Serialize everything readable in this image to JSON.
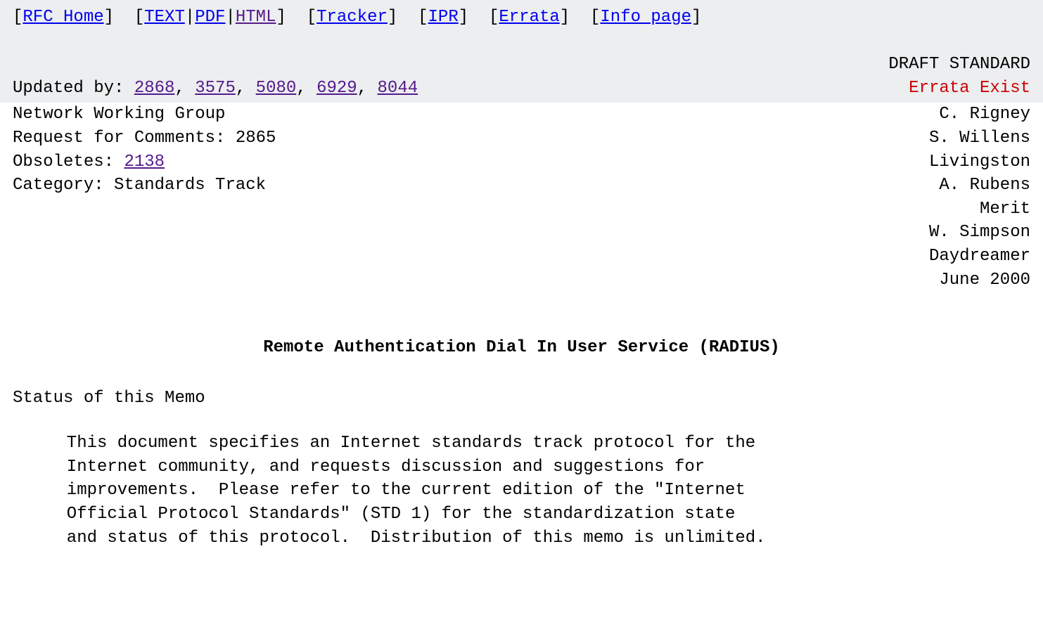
{
  "nav": {
    "rfc_home": "RFC Home",
    "text": "TEXT",
    "pdf": "PDF",
    "html": "HTML",
    "tracker": "Tracker",
    "ipr": "IPR",
    "errata": "Errata",
    "info_page": "Info page"
  },
  "header": {
    "draft_std": "DRAFT STANDARD",
    "updated_by_label": "Updated by: ",
    "updated_by": [
      "2868",
      "3575",
      "5080",
      "6929",
      "8044"
    ],
    "errata_exist": "Errata Exist",
    "group": "Network Working Group",
    "rfc_line": "Request for Comments: 2865",
    "obsoletes_label": "Obsoletes: ",
    "obsoletes": "2138",
    "category": "Category: Standards Track"
  },
  "authors": {
    "a1": "C. Rigney",
    "a2": "S. Willens",
    "a3": "Livingston",
    "a4": "A. Rubens",
    "a5": "Merit",
    "a6": "W. Simpson",
    "a7": "Daydreamer",
    "date": "June 2000"
  },
  "title": "Remote Authentication Dial In User Service (RADIUS)",
  "status": {
    "heading": "Status of this Memo",
    "body": "This document specifies an Internet standards track protocol for the\nInternet community, and requests discussion and suggestions for\nimprovements.  Please refer to the current edition of the \"Internet\nOfficial Protocol Standards\" (STD 1) for the standardization state\nand status of this protocol.  Distribution of this memo is unlimited."
  }
}
